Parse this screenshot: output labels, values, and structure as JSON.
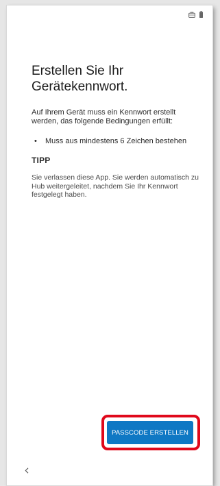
{
  "status_bar": {
    "icons": [
      "briefcase-icon",
      "battery-icon"
    ]
  },
  "screen": {
    "title": "Erstellen Sie Ihr Gerätekennwort.",
    "intro": "Auf Ihrem Gerät muss ein Kennwort erstellt werden, das folgende Bedingungen erfüllt:",
    "requirements": [
      {
        "bullet": "•",
        "text": "Muss aus mindestens 6 Zeichen bestehen"
      }
    ],
    "tip_heading": "TIPP",
    "tip_text": "Sie verlassen diese App. Sie werden automatisch zu Hub weitergeleitet, nachdem Sie Ihr Kennwort festgelegt haben."
  },
  "actions": {
    "primary_label": "PASSCODE ERSTELLEN",
    "primary_color": "#0f78c4",
    "highlight_color": "#e0081b"
  },
  "nav": {
    "back_icon": "chevron-left-icon"
  }
}
